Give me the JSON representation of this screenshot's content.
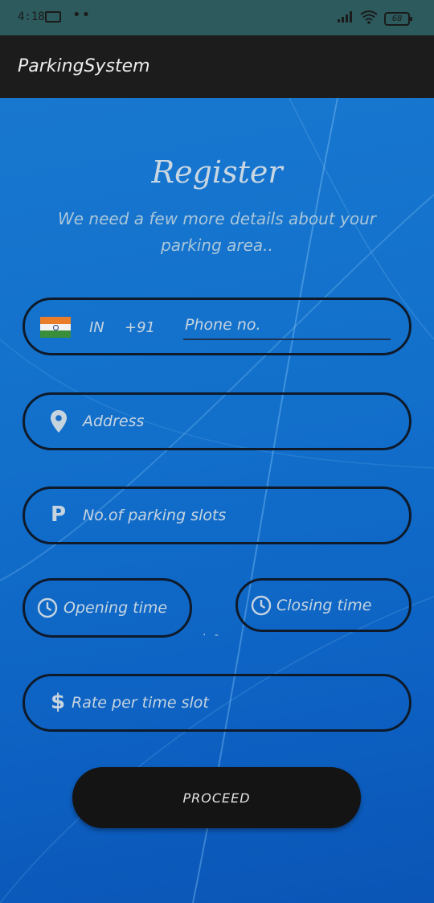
{
  "status_bar": {
    "time": "4:18",
    "battery": "68"
  },
  "app_bar": {
    "title": "ParkingSystem"
  },
  "form": {
    "heading": "Register",
    "subtitle": "We need a few more details about your parking area..",
    "phone": {
      "country_code": "IN",
      "dial_code": "+91",
      "placeholder": "Phone no."
    },
    "address": {
      "placeholder": "Address"
    },
    "slots": {
      "icon_letter": "P",
      "placeholder": "No.of parking slots"
    },
    "opening_time": {
      "placeholder": "Opening time"
    },
    "closing_time": {
      "placeholder": "Closing time"
    },
    "rate": {
      "icon_symbol": "$",
      "placeholder": "Rate per time slot"
    },
    "proceed_label": "PROCEED"
  },
  "icons": {
    "laptop": "laptop-icon",
    "signal": "signal-icon",
    "wifi": "wifi-icon",
    "battery": "battery-icon",
    "flag": "india-flag-icon",
    "location": "location-pin-icon",
    "parking": "parking-icon",
    "clock": "clock-icon",
    "dollar": "dollar-icon"
  },
  "colors": {
    "app_bar": "#1c1c1c",
    "status_bar": "#2d5a5c",
    "field_border": "#0e1a2a",
    "button": "#141414",
    "background": "#1270cb"
  }
}
